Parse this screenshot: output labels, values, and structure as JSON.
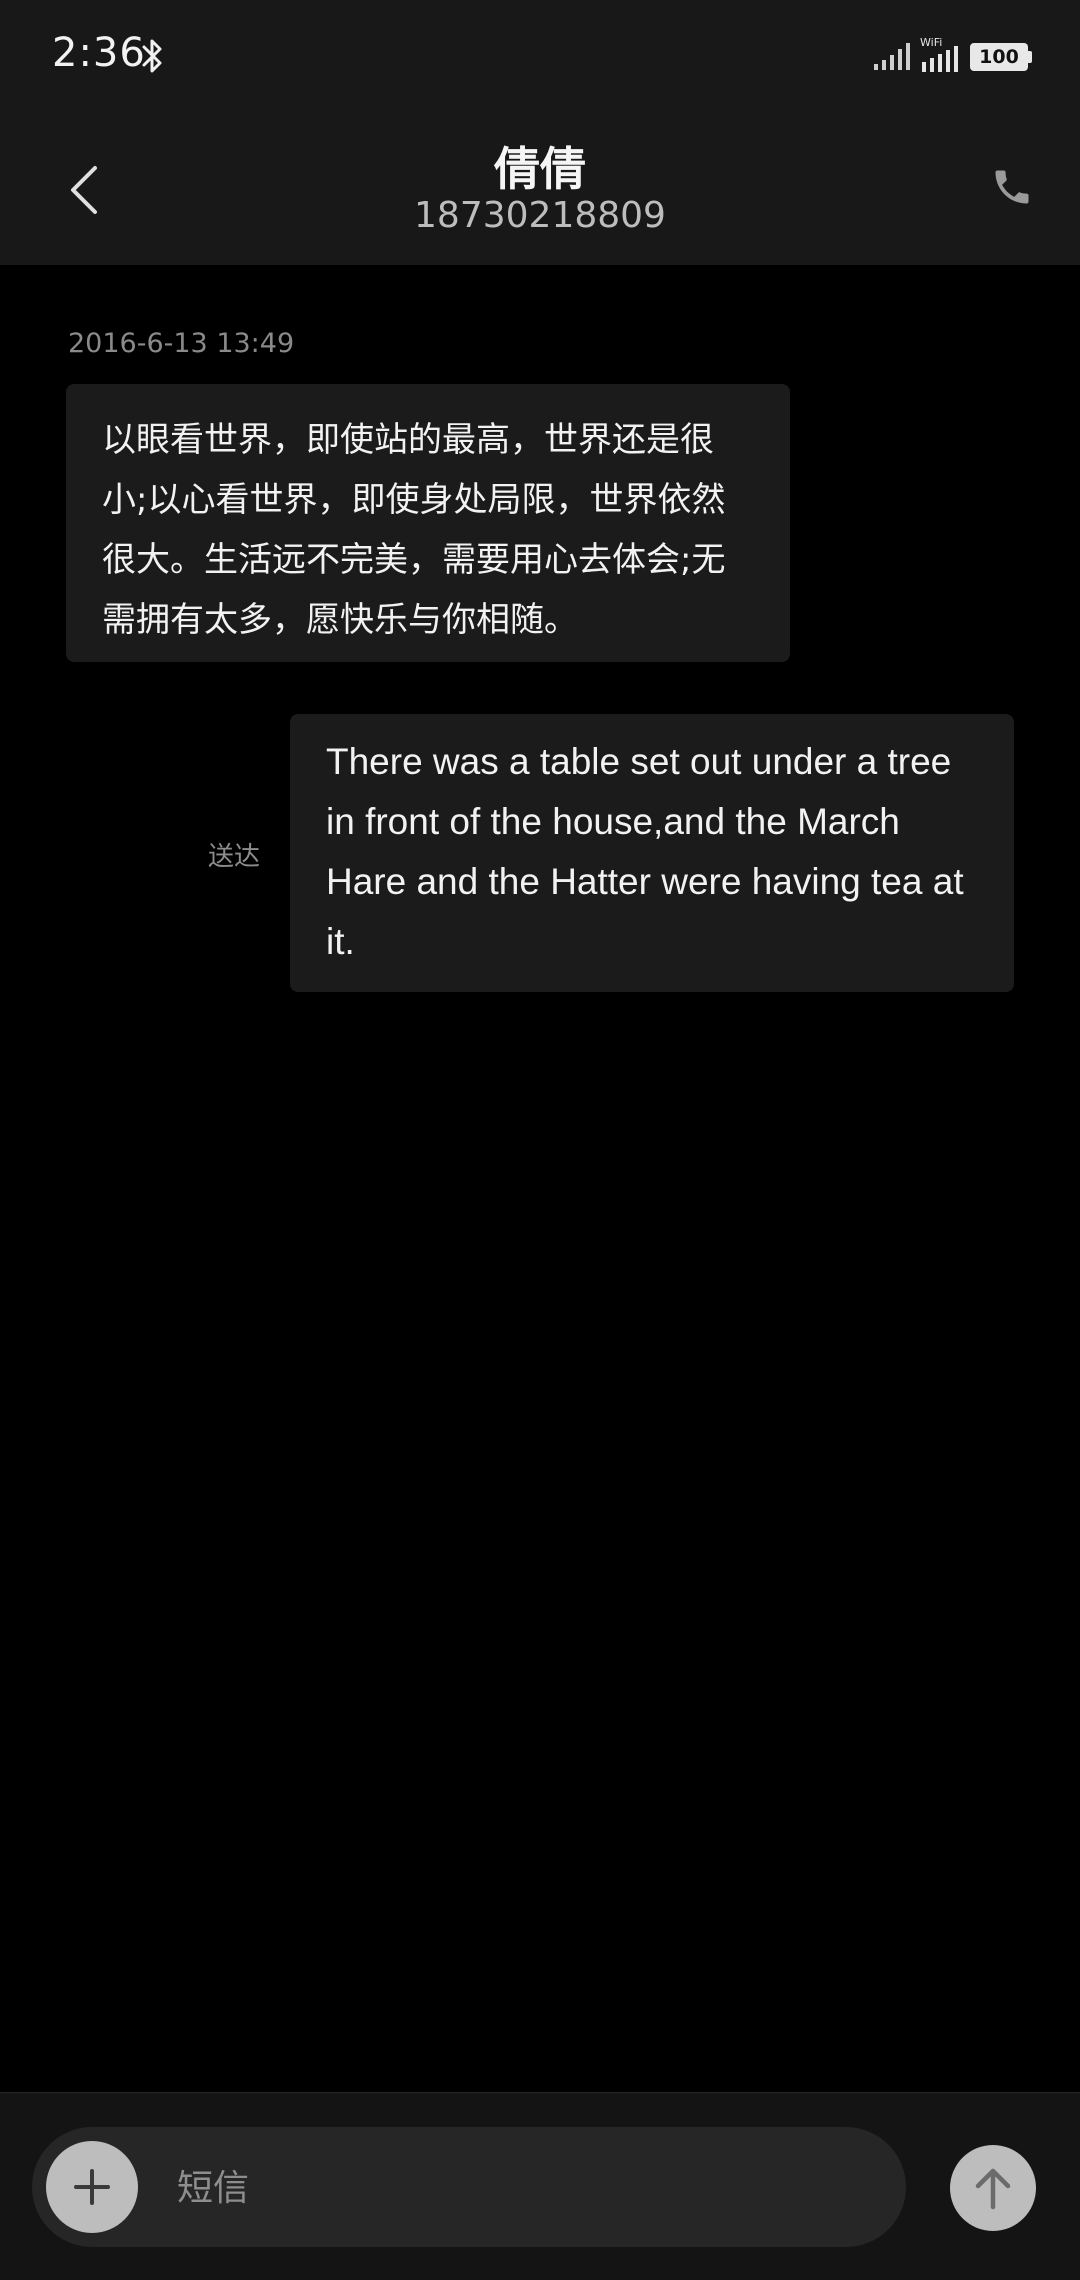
{
  "status_bar": {
    "time": "2:36",
    "wifi_label": "WiFi",
    "battery": "100"
  },
  "header": {
    "contact_name": "倩倩",
    "contact_number": "18730218809"
  },
  "conversation": {
    "timestamp": "2016-6-13 13:49",
    "incoming_message": "以眼看世界，即使站的最高，世界还是很小;以心看世界，即使身处局限，世界依然很大。生活远不完美，需要用心去体会;无需拥有太多，愿快乐与你相随。",
    "outgoing_message": "There was a table set out under a tree in front of the house,and the March Hare and the Hatter were having tea at it.",
    "delivery_status": "送达"
  },
  "composer": {
    "placeholder": "短信",
    "value": ""
  },
  "icons": {
    "back": "chevron-left-icon",
    "call": "phone-icon",
    "attach": "plus-icon",
    "send": "arrow-up-icon",
    "bluetooth": "bluetooth-icon"
  },
  "colors": {
    "background": "#000000",
    "bar": "#181818",
    "bubble": "#1b1b1b",
    "button": "#bdbdbd"
  }
}
